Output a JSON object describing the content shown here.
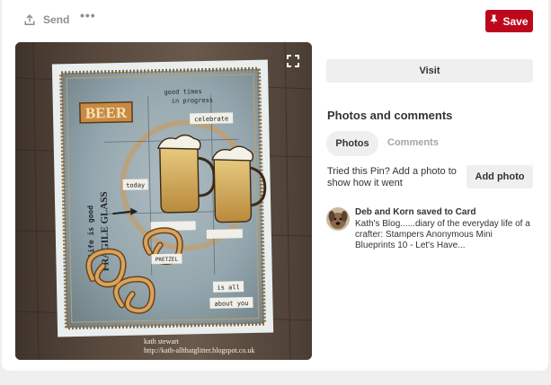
{
  "colors": {
    "brand_red": "#bd081c",
    "pill_gray": "#efefef",
    "text_dark": "#333333",
    "text_muted": "#8e8e8e"
  },
  "toolbar": {
    "send_label": "Send",
    "send_icon": "upload-icon",
    "more_label": "•••",
    "save_label": "Save",
    "save_icon": "pushpin-icon"
  },
  "pin": {
    "image_description_icon": "pin-image",
    "expand_icon": "expand-icon",
    "credit_line1": "kath stewart",
    "credit_line2": "http://kath-allthatglitter.blogspot.co.uk",
    "card_words": {
      "beer": "BEER",
      "good_times": "good times",
      "in_progress": "in progress",
      "celebrate": "celebrate",
      "today": "today",
      "life_is_good": "life is good",
      "fragile_glass": "FRAGILE GLASS",
      "pretzel": "PRETZEL",
      "is_all": "is all",
      "about_you": "about you"
    }
  },
  "sidebar": {
    "visit_label": "Visit",
    "section_title": "Photos and comments",
    "tabs": [
      {
        "label": "Photos",
        "active": true
      },
      {
        "label": "Comments",
        "active": false
      }
    ],
    "tried_text": "Tried this Pin? Add a photo to show how it went",
    "add_photo_label": "Add photo"
  },
  "activity": {
    "avatar_icon": "dog-avatar",
    "headline": "Deb and Korn saved to Card",
    "description": "Kath's Blog......diary of the everyday life of a crafter: Stampers Anonymous Mini Blueprints 10 - Let's Have..."
  }
}
